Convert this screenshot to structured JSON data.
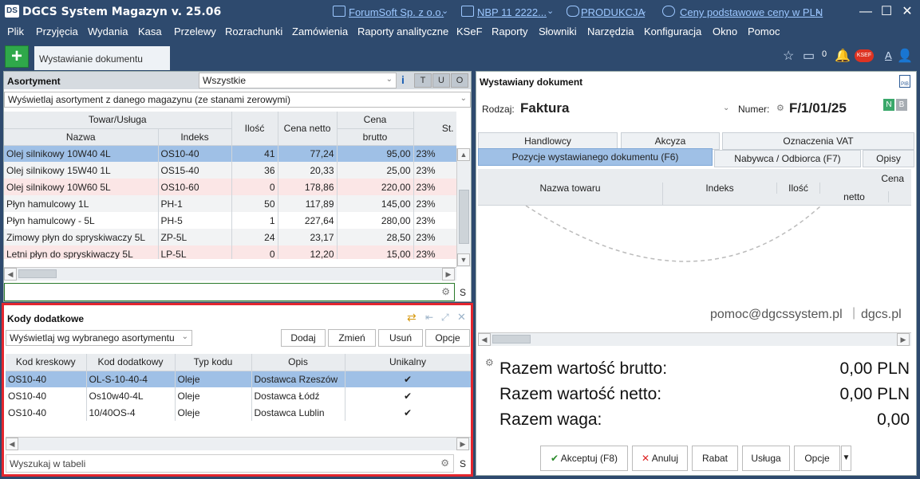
{
  "titlebar": {
    "app_title": "DGCS System Magazyn v. 25.06",
    "logo": "DS",
    "company": "ForumSoft Sp. z o.o.",
    "nbp": "NBP 11 2222...",
    "database": "PRODUKCJA",
    "price_list": "Ceny podstawowe ceny w PLN"
  },
  "menu": [
    "Plik",
    "Przyjęcia",
    "Wydania",
    "Kasa",
    "Przelewy",
    "Rozrachunki",
    "Zamówienia",
    "Raporty analityczne",
    "KSeF",
    "Raporty",
    "Słowniki",
    "Narzędzia",
    "Konfiguracja",
    "Okno",
    "Pomoc"
  ],
  "tabs": {
    "plus": "+",
    "doc_tab": "Wystawianie dokumentu",
    "notif_count": "0",
    "ksef": "KSEF",
    "font_a": "A"
  },
  "assortment": {
    "title": "Asortyment",
    "filter": "Wszystkie",
    "info": "i",
    "tuo": [
      "T",
      "U",
      "O"
    ],
    "mode": "Wyświetlaj asortyment z danego magazynu (ze stanami zerowymi)",
    "headers": {
      "group": "Towar/Usługa",
      "name": "Nazwa",
      "index": "Indeks",
      "qty": "Ilość",
      "net": "Cena netto",
      "price_group": "Cena",
      "gross": "brutto",
      "vat": "St."
    },
    "rows": [
      {
        "name": "Olej silnikowy 10W40 4L",
        "index": "OS10-40",
        "qty": "41",
        "net": "77,24",
        "gross": "95,00",
        "vat": "23%",
        "style": "sel"
      },
      {
        "name": "Olej silnikowy 15W40 1L",
        "index": "OS15-40",
        "qty": "36",
        "net": "20,33",
        "gross": "25,00",
        "vat": "23%",
        "style": "gray"
      },
      {
        "name": "Olej silnikowy 10W60 5L",
        "index": "OS10-60",
        "qty": "0",
        "net": "178,86",
        "gross": "220,00",
        "vat": "23%",
        "style": "pink"
      },
      {
        "name": "Płyn hamulcowy 1L",
        "index": "PH-1",
        "qty": "50",
        "net": "117,89",
        "gross": "145,00",
        "vat": "23%",
        "style": "gray"
      },
      {
        "name": "Płyn hamulcowy - 5L",
        "index": "PH-5",
        "qty": "1",
        "net": "227,64",
        "gross": "280,00",
        "vat": "23%",
        "style": "white"
      },
      {
        "name": "Zimowy płyn do spryskiwaczy 5L",
        "index": "ZP-5L",
        "qty": "24",
        "net": "23,17",
        "gross": "28,50",
        "vat": "23%",
        "style": "gray"
      },
      {
        "name": "Letni płyn do spryskiwaczy 5L",
        "index": "LP-5L",
        "qty": "0",
        "net": "12,20",
        "gross": "15,00",
        "vat": "23%",
        "style": "pink"
      }
    ],
    "search_value": "",
    "s_label": "S"
  },
  "kody": {
    "title": "Kody dodatkowe",
    "mode": "Wyświetlaj wg wybranego asortymentu",
    "buttons": {
      "add": "Dodaj",
      "edit": "Zmień",
      "delete": "Usuń",
      "options": "Opcje"
    },
    "headers": {
      "barcode": "Kod kreskowy",
      "extra": "Kod dodatkowy",
      "type": "Typ kodu",
      "desc": "Opis",
      "unique": "Unikalny"
    },
    "rows": [
      {
        "barcode": "OS10-40",
        "extra": "OL-S-10-40-4",
        "type": "Oleje",
        "desc": "Dostawca Rzeszów",
        "unique": "✔",
        "style": "sel"
      },
      {
        "barcode": "OS10-40",
        "extra": "Os10w40-4L",
        "type": "Oleje",
        "desc": "Dostawca Łódź",
        "unique": "✔",
        "style": "white"
      },
      {
        "barcode": "OS10-40",
        "extra": "10/40OS-4",
        "type": "Oleje",
        "desc": "Dostawca Lublin",
        "unique": "✔",
        "style": "white"
      }
    ],
    "search_placeholder": "Wyszukaj w tabeli",
    "s_label": "S"
  },
  "document": {
    "title": "Wystawiany dokument",
    "kind_label": "Rodzaj:",
    "kind": "Faktura",
    "number_label": "Numer:",
    "number": "F/1/01/25",
    "nb": [
      "N",
      "B"
    ],
    "tabs_row1": [
      "Handlowcy",
      "Akcyza",
      "Oznaczenia VAT"
    ],
    "tabs_row2": [
      "Pozycje wystawianego dokumentu (F6)",
      "Nabywca / Odbiorca (F7)",
      "Opisy"
    ],
    "headers": {
      "name": "Nazwa towaru",
      "index": "Indeks",
      "qty": "Ilość",
      "price": "Cena",
      "net": "netto"
    },
    "email": "pomoc@dgcssystem.pl",
    "site": "dgcs.pl",
    "totals": [
      {
        "label": "Razem wartość brutto:",
        "value": "0,00 PLN"
      },
      {
        "label": "Razem wartość netto:",
        "value": "0,00 PLN"
      },
      {
        "label": "Razem waga:",
        "value": "0,00"
      }
    ],
    "buttons": {
      "accept": "Akceptuj (F8)",
      "cancel": "Anuluj",
      "discount": "Rabat",
      "service": "Usługa",
      "options": "Opcje"
    }
  }
}
